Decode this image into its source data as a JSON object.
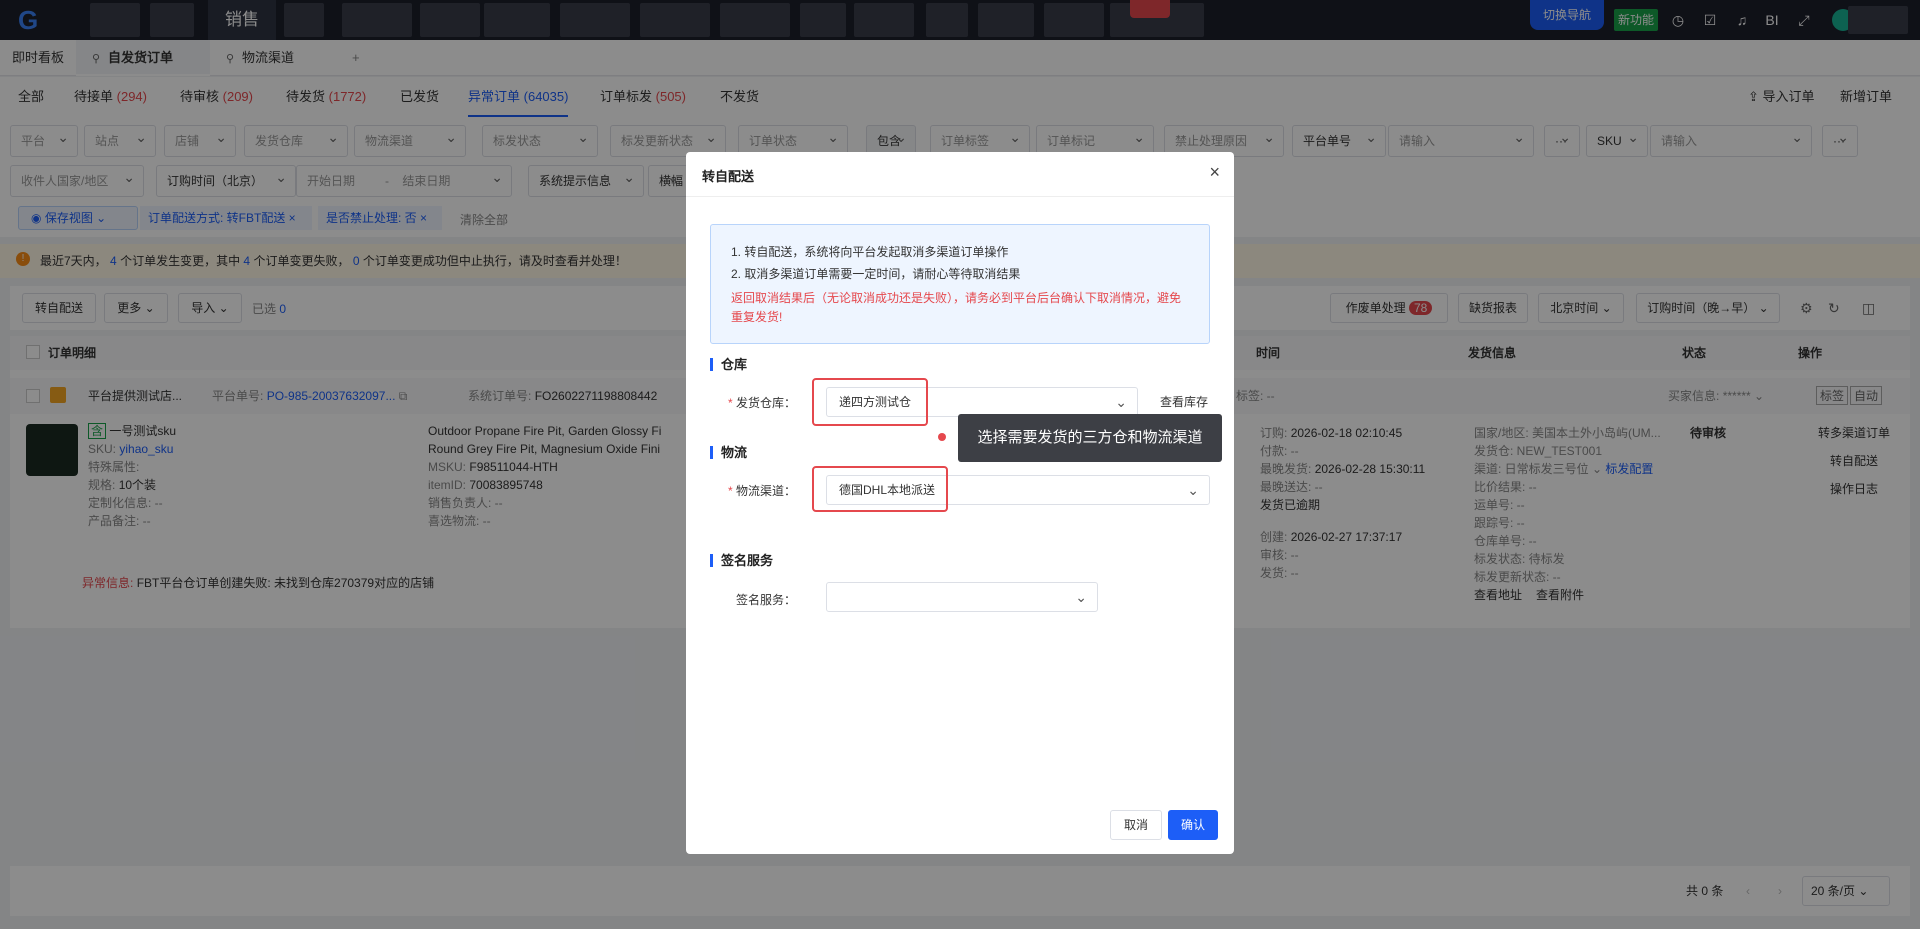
{
  "topbar": {
    "nav_sales": "销售",
    "switch_nav": "切换导航",
    "new_feature": "新功能",
    "bi": "BI"
  },
  "tabs": [
    {
      "label": "即时看板"
    },
    {
      "label": "自发货订单"
    },
    {
      "label": "物流渠道"
    },
    {
      "label": "+"
    }
  ],
  "subtabs": [
    {
      "label": "全部",
      "count": ""
    },
    {
      "label": "待接单",
      "count": "(294)"
    },
    {
      "label": "待审核",
      "count": "(209)"
    },
    {
      "label": "待发货",
      "count": "(1772)"
    },
    {
      "label": "已发货",
      "count": ""
    },
    {
      "label": "异常订单",
      "count": "(64035)"
    },
    {
      "label": "订单标发",
      "count": "(505)"
    },
    {
      "label": "不发货",
      "count": ""
    }
  ],
  "header_actions": {
    "import": "导入订单",
    "new": "新增订单"
  },
  "filters_row1": [
    "平台",
    "站点",
    "店铺",
    "发货仓库",
    "物流渠道",
    "标发状态",
    "标发更新状态",
    "订单状态",
    "包含",
    "订单标签",
    "订单标记",
    "禁止处理原因",
    "平台单号",
    "请输入",
    "SKU",
    "请输入"
  ],
  "filters_row2": [
    "收件人国家/地区",
    "订购时间（北京）",
    "开始日期",
    "-",
    "结束日期",
    "系统提示信息",
    "横幅"
  ],
  "view_bar": {
    "save_view": "保存视图",
    "tag1": "订单配送方式: 转FBT配送",
    "tag2": "是否禁止处理: 否",
    "clear": "清除全部"
  },
  "alert": {
    "p1": "最近7天内，",
    "n1": "4",
    "p2": "个订单发生变更，其中",
    "n2": "4",
    "p3": "个订单变更失败，",
    "n3": "0",
    "p4": "个订单变更成功但中止执行，请及时查看并处理！"
  },
  "toolbar": {
    "to_self": "转自配送",
    "more": "更多",
    "import": "导入",
    "selected": "已选",
    "selected_count": "0",
    "void": "作废单处理",
    "void_count": "78",
    "shortage": "缺货报表",
    "tz": "北京时间",
    "sort": "订购时间（晚→早）"
  },
  "table_header": {
    "detail": "订单明细",
    "time": "时间",
    "ship": "发货信息",
    "status": "状态",
    "ops": "操作"
  },
  "order": {
    "shop": "平台提供测试店...",
    "platform_no_label": "平台单号:",
    "platform_no": "PO-985-20037632097...",
    "sys_no_label": "系统订单号:",
    "sys_no": "FO2602271198808442",
    "tags_label": "标签: --",
    "buyer_label": "买家信息:",
    "buyer_value": "******",
    "btn_flag": "标签",
    "btn_auto": "自动",
    "product_badge": "含",
    "product_name": "一号测试sku",
    "sku_label": "SKU:",
    "sku": "yihao_sku",
    "special": "特殊属性:",
    "spec_label": "规格:",
    "spec": "10个装",
    "custom": "定制化信息: --",
    "note": "产品备注: --",
    "title_en1": "Outdoor Propane Fire Pit, Garden Glossy Fi",
    "title_en2": "Round Grey Fire Pit, Magnesium Oxide Fini",
    "msku_label": "MSKU:",
    "msku": "F98511044-HTH",
    "itemid_label": "itemID:",
    "itemid": "70083895748",
    "sales_owner": "销售负责人: --",
    "logistics": "喜选物流: --",
    "time_order": "订购:",
    "time_order_v": "2026-02-18 02:10:45",
    "time_paid": "付款: --",
    "time_latest_ship": "最晚发货:",
    "time_latest_ship_v": "2026-02-28 15:30:11",
    "time_latest_deliver": "最晚送达: --",
    "overdue": "发货已逾期",
    "time_created": "创建:",
    "time_created_v": "2026-02-27 17:37:17",
    "time_audit": "审核: --",
    "time_ship": "发货: --",
    "ship_country": "国家/地区: 美国本土外小岛屿(UM...",
    "ship_wh": "发货仓: NEW_TEST001",
    "ship_channel": "渠道: 日常标发三号位",
    "ship_config": "标发配置",
    "ship_compare": "比价结果: --",
    "ship_waybill": "运单号: --",
    "ship_track": "跟踪号: --",
    "ship_wh_no": "仓库单号: --",
    "ship_flag_status": "标发状态: 待标发",
    "ship_flag_update": "标发更新状态: --",
    "view_addr": "查看地址",
    "view_attach": "查看附件",
    "status": "待审核",
    "op1": "转多渠道订单",
    "op2": "转自配送",
    "op3": "操作日志",
    "error_label": "异常信息:",
    "error_text": "FBT平台仓订单创建失败: 未找到仓库270379对应的店铺"
  },
  "pagination": {
    "total": "共 0 条",
    "page_size": "20 条/页"
  },
  "modal": {
    "title": "转自配送",
    "close": "×",
    "info1": "1. 转自配送，系统将向平台发起取消多渠道订单操作",
    "info2": "2. 取消多渠道订单需要一定时间，请耐心等待取消结果",
    "warn": "返回取消结果后（无论取消成功还是失败），请务必到平台后台确认下取消情况，避免重复发货!",
    "section_wh": "仓库",
    "wh_label": "发货仓库：",
    "wh_value": "递四方测试仓",
    "view_stock": "查看库存",
    "section_logistics": "物流",
    "channel_label": "物流渠道：",
    "channel_value": "德国DHL本地派送",
    "section_sign": "签名服务",
    "sign_label": "签名服务：",
    "sign_value": "",
    "cancel": "取消",
    "confirm": "确认"
  },
  "tooltip": "选择需要发货的三方仓和物流渠道"
}
